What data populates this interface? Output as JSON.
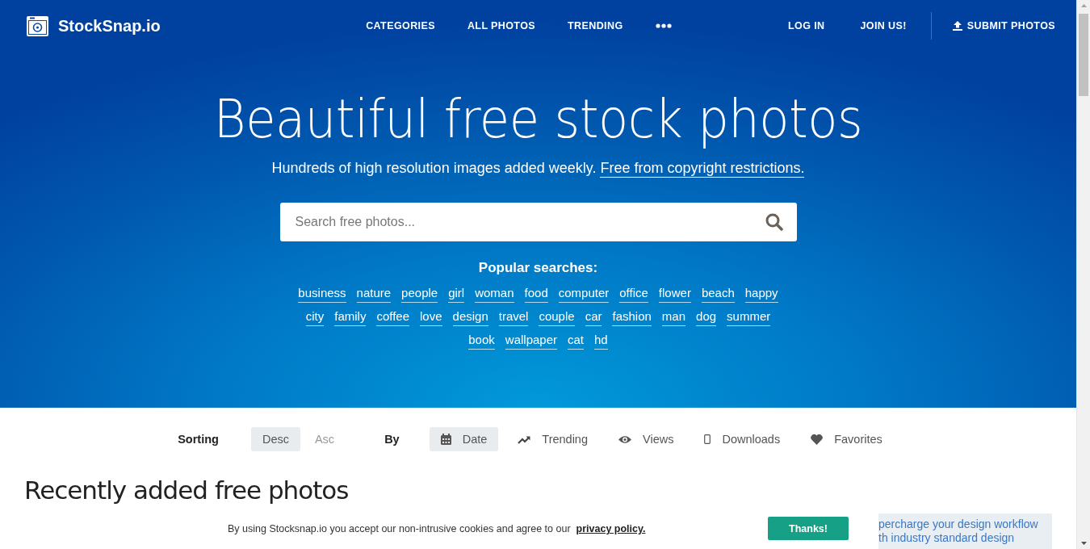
{
  "header": {
    "logo": "StockSnap.io",
    "nav": [
      "CATEGORIES",
      "ALL PHOTOS",
      "TRENDING"
    ],
    "account": [
      "LOG IN",
      "JOIN US!"
    ],
    "submit": "SUBMIT PHOTOS"
  },
  "hero": {
    "title": "Beautiful free stock photos",
    "subtitle": "Hundreds of high resolution images added weekly.",
    "subtitle_link": "Free from copyright restrictions.",
    "search": {
      "placeholder": "Search free photos..."
    },
    "popular_label": "Popular searches:",
    "tag_rows": [
      [
        "business",
        "nature",
        "people",
        "girl",
        "woman",
        "food",
        "computer",
        "office",
        "flower",
        "beach",
        "happy"
      ],
      [
        "city",
        "family",
        "coffee",
        "love",
        "design",
        "travel",
        "couple",
        "car",
        "fashion",
        "man",
        "dog",
        "summer"
      ],
      [
        "book",
        "wallpaper",
        "cat",
        "hd"
      ]
    ]
  },
  "sorting": {
    "label": "Sorting",
    "orders": [
      {
        "label": "Desc",
        "selected": true
      },
      {
        "label": "Asc",
        "selected": false
      }
    ],
    "by_label": "By",
    "fields": [
      {
        "label": "Date",
        "kind": "calendar",
        "selected": true
      },
      {
        "label": "Trending",
        "kind": "trend",
        "selected": false
      },
      {
        "label": "Views",
        "kind": "eye",
        "selected": false
      },
      {
        "label": "Downloads",
        "kind": "phone",
        "selected": false
      },
      {
        "label": "Favorites",
        "kind": "heart",
        "selected": false
      }
    ]
  },
  "content": {
    "heading": "Recently added free photos",
    "ad_lines": [
      "percharge your design workflow",
      "th industry standard design"
    ]
  },
  "cookie_banner": {
    "text": "By using Stocksnap.io you accept our non-intrusive cookies and agree to our",
    "link": "privacy policy.",
    "button": "Thanks!"
  }
}
